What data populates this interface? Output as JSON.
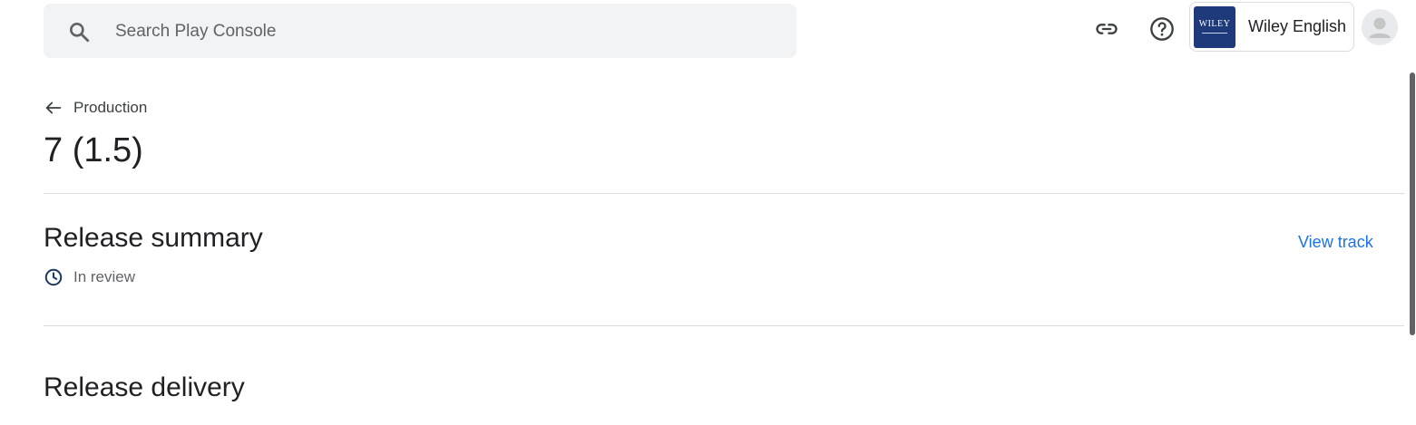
{
  "search": {
    "placeholder": "Search Play Console"
  },
  "header": {
    "account_name": "Wiley English",
    "app_logo_text": "WILEY",
    "icons": [
      "search-icon",
      "link-icon",
      "help-icon",
      "avatar-icon"
    ]
  },
  "breadcrumb": {
    "label": "Production"
  },
  "page": {
    "title": "7 (1.5)"
  },
  "release_summary": {
    "heading": "Release summary",
    "status": "In review",
    "view_track_label": "View track"
  },
  "release_delivery": {
    "heading": "Release delivery"
  },
  "colors": {
    "link": "#1a73e8",
    "search_bg": "#f1f3f4",
    "divider": "#dadce0",
    "status_icon": "#1e3a5f",
    "app_logo_bg": "#1e3a7b"
  }
}
